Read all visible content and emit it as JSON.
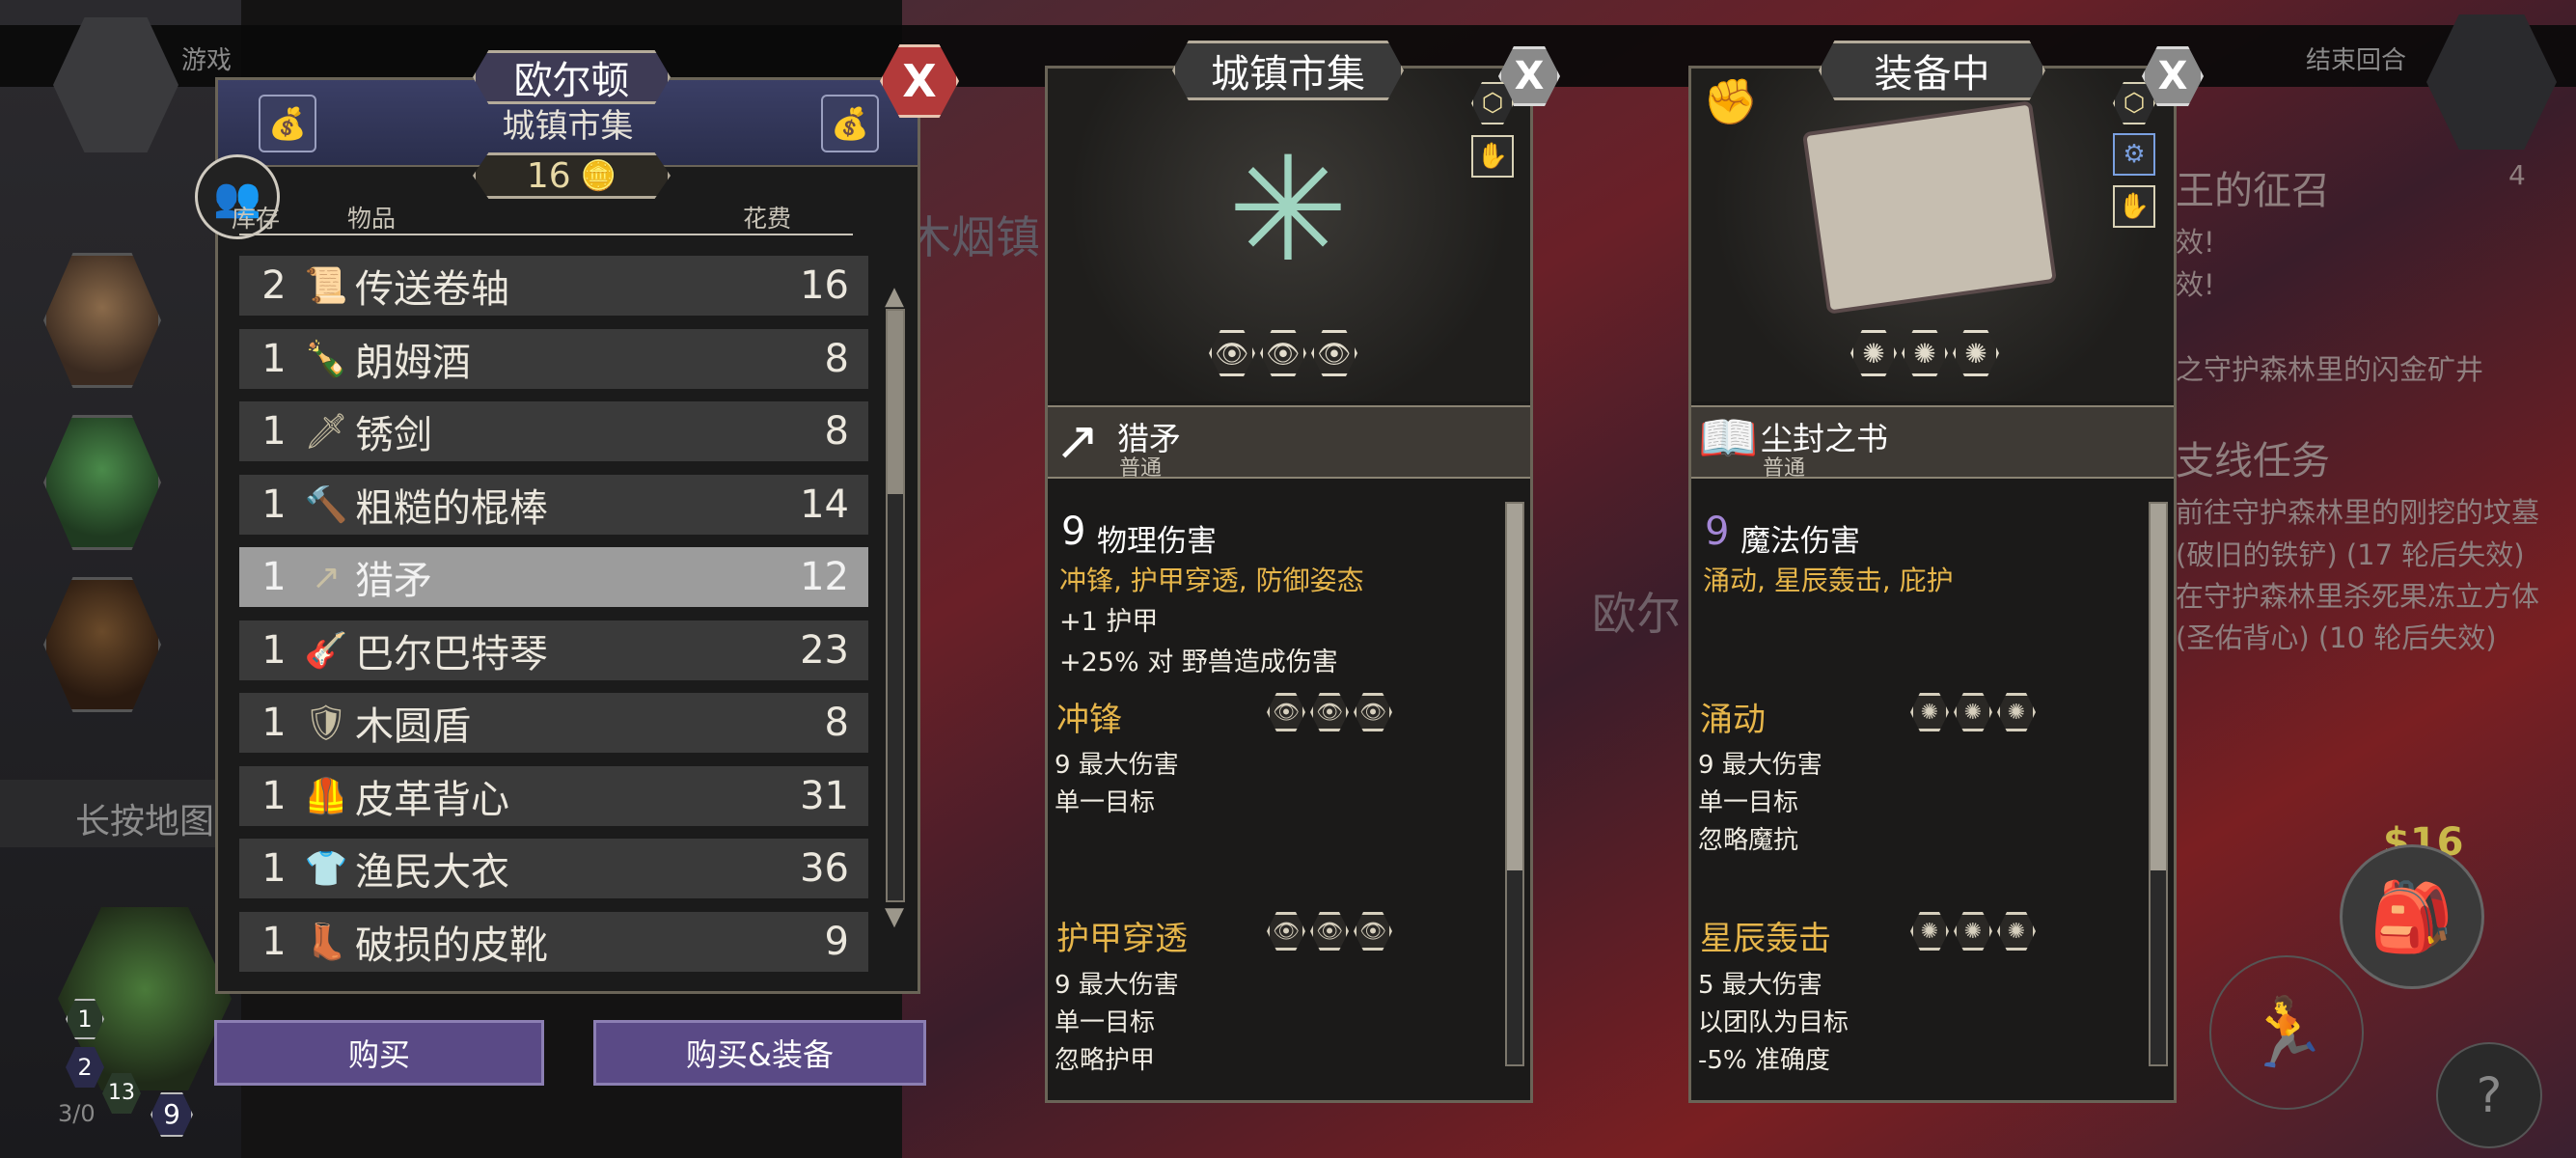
{
  "top_bar": {
    "game_label": "游戏",
    "end_turn": "结束回合"
  },
  "quests": {
    "partial_title": "王的征召",
    "lines": [
      "效!",
      "效!",
      "之守护森林里的闪金矿井"
    ],
    "side_title": "支线任务",
    "side_lines": [
      "前往守护森林里的刚挖的坟墓",
      "(破旧的铁铲) (17 轮后失效)",
      "在守护森林里杀死果冻立方体",
      "(圣佑背心) (10 轮后失效)"
    ],
    "counter": "4"
  },
  "left_hint": "长按地图",
  "map_label_town1": "木烟镇",
  "map_label_town2": "欧尔",
  "hud": {
    "gold": "$16",
    "stats": [
      "1",
      "2",
      "13",
      "9"
    ],
    "small": "3/0"
  },
  "shop": {
    "town": "欧尔顿",
    "market": "城镇市集",
    "gold": "16",
    "headers": {
      "stock": "库存",
      "item": "物品",
      "cost": "花费"
    },
    "items": [
      {
        "qty": "2",
        "icon": "scroll-icon",
        "glyph": "📜",
        "name": "传送卷轴",
        "cost": "16"
      },
      {
        "qty": "1",
        "icon": "bottle-icon",
        "glyph": "🍾",
        "name": "朗姆酒",
        "cost": "8"
      },
      {
        "qty": "1",
        "icon": "sword-icon",
        "glyph": "🗡",
        "name": "锈剑",
        "cost": "8"
      },
      {
        "qty": "1",
        "icon": "club-icon",
        "glyph": "🔨",
        "name": "粗糙的棍棒",
        "cost": "14"
      },
      {
        "qty": "1",
        "icon": "spear-icon",
        "glyph": "↗",
        "name": "猎矛",
        "cost": "12"
      },
      {
        "qty": "1",
        "icon": "lute-icon",
        "glyph": "🎸",
        "name": "巴尔巴特琴",
        "cost": "23"
      },
      {
        "qty": "1",
        "icon": "shield-icon",
        "glyph": "🛡",
        "name": "木圆盾",
        "cost": "8"
      },
      {
        "qty": "1",
        "icon": "vest-icon",
        "glyph": "🦺",
        "name": "皮革背心",
        "cost": "31"
      },
      {
        "qty": "1",
        "icon": "shirt-icon",
        "glyph": "👕",
        "name": "渔民大衣",
        "cost": "36"
      },
      {
        "qty": "1",
        "icon": "boot-icon",
        "glyph": "👢",
        "name": "破损的皮靴",
        "cost": "9"
      }
    ],
    "selected_index": 4,
    "buy": "购买",
    "buy_equip": "购买&装备"
  },
  "card_market": {
    "tag": "城镇市集",
    "item_name": "猎矛",
    "rarity": "普通",
    "damage": "9",
    "damage_type": "物理伤害",
    "traits": "冲锋, 护甲穿透, 防御姿态",
    "stats": [
      "+1 护甲",
      "+25% 对 野兽造成伤害"
    ],
    "abilities": [
      {
        "name": "冲锋",
        "lines": [
          "9 最大伤害",
          "单一目标"
        ]
      },
      {
        "name": "护甲穿透",
        "lines": [
          "9 最大伤害",
          "单一目标",
          "忽略护甲"
        ]
      }
    ]
  },
  "card_equipped": {
    "tag": "装备中",
    "item_name": "尘封之书",
    "rarity": "普通",
    "damage": "9",
    "damage_type": "魔法伤害",
    "traits": "涌动, 星辰轰击, 庇护",
    "abilities": [
      {
        "name": "涌动",
        "lines": [
          "9 最大伤害",
          "单一目标",
          "忽略魔抗"
        ]
      },
      {
        "name": "星辰轰击",
        "lines": [
          "5 最大伤害",
          "以团队为目标",
          "-5% 准确度"
        ]
      }
    ]
  },
  "colors": {
    "accent_gold": "#e7b64a",
    "button_purple": "#5a4a86",
    "close_red": "#b33a3a",
    "magic_purple": "#a487d6"
  }
}
